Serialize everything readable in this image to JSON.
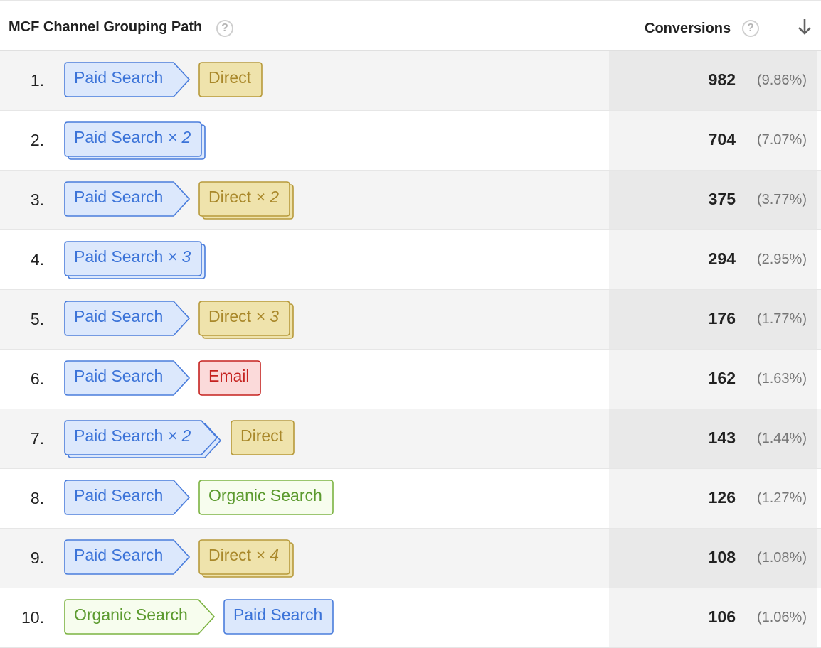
{
  "header": {
    "path_label": "MCF Channel Grouping Path",
    "conversions_label": "Conversions",
    "help_glyph": "?",
    "sort_icon": "arrow-down-icon"
  },
  "colors": {
    "blue": {
      "fill": "#dce8fc",
      "stroke": "#4a7ddc",
      "text": "#3b73d8"
    },
    "yellow": {
      "fill": "#efe3ac",
      "stroke": "#b79a3b",
      "text": "#a9882a"
    },
    "red": {
      "fill": "#fbdada",
      "stroke": "#c5221f",
      "text": "#c5221f"
    },
    "green": {
      "fill": "#f7fdee",
      "stroke": "#7cb342",
      "text": "#5b9a2e"
    }
  },
  "rows": [
    {
      "index": "1.",
      "conversions": "982",
      "percent": "(9.86%)",
      "path": [
        {
          "label": "Paid Search",
          "mult": "",
          "color": "blue"
        },
        {
          "label": "Direct",
          "mult": "",
          "color": "yellow"
        }
      ]
    },
    {
      "index": "2.",
      "conversions": "704",
      "percent": "(7.07%)",
      "path": [
        {
          "label": "Paid Search",
          "mult": "× 2",
          "color": "blue"
        }
      ]
    },
    {
      "index": "3.",
      "conversions": "375",
      "percent": "(3.77%)",
      "path": [
        {
          "label": "Paid Search",
          "mult": "",
          "color": "blue"
        },
        {
          "label": "Direct",
          "mult": "× 2",
          "color": "yellow"
        }
      ]
    },
    {
      "index": "4.",
      "conversions": "294",
      "percent": "(2.95%)",
      "path": [
        {
          "label": "Paid Search",
          "mult": "× 3",
          "color": "blue"
        }
      ]
    },
    {
      "index": "5.",
      "conversions": "176",
      "percent": "(1.77%)",
      "path": [
        {
          "label": "Paid Search",
          "mult": "",
          "color": "blue"
        },
        {
          "label": "Direct",
          "mult": "× 3",
          "color": "yellow"
        }
      ]
    },
    {
      "index": "6.",
      "conversions": "162",
      "percent": "(1.63%)",
      "path": [
        {
          "label": "Paid Search",
          "mult": "",
          "color": "blue"
        },
        {
          "label": "Email",
          "mult": "",
          "color": "red"
        }
      ]
    },
    {
      "index": "7.",
      "conversions": "143",
      "percent": "(1.44%)",
      "path": [
        {
          "label": "Paid Search",
          "mult": "× 2",
          "color": "blue"
        },
        {
          "label": "Direct",
          "mult": "",
          "color": "yellow"
        }
      ]
    },
    {
      "index": "8.",
      "conversions": "126",
      "percent": "(1.27%)",
      "path": [
        {
          "label": "Paid Search",
          "mult": "",
          "color": "blue"
        },
        {
          "label": "Organic Search",
          "mult": "",
          "color": "green"
        }
      ]
    },
    {
      "index": "9.",
      "conversions": "108",
      "percent": "(1.08%)",
      "path": [
        {
          "label": "Paid Search",
          "mult": "",
          "color": "blue"
        },
        {
          "label": "Direct",
          "mult": "× 4",
          "color": "yellow"
        }
      ]
    },
    {
      "index": "10.",
      "conversions": "106",
      "percent": "(1.06%)",
      "path": [
        {
          "label": "Organic Search",
          "mult": "",
          "color": "green"
        },
        {
          "label": "Paid Search",
          "mult": "",
          "color": "blue"
        }
      ]
    }
  ]
}
